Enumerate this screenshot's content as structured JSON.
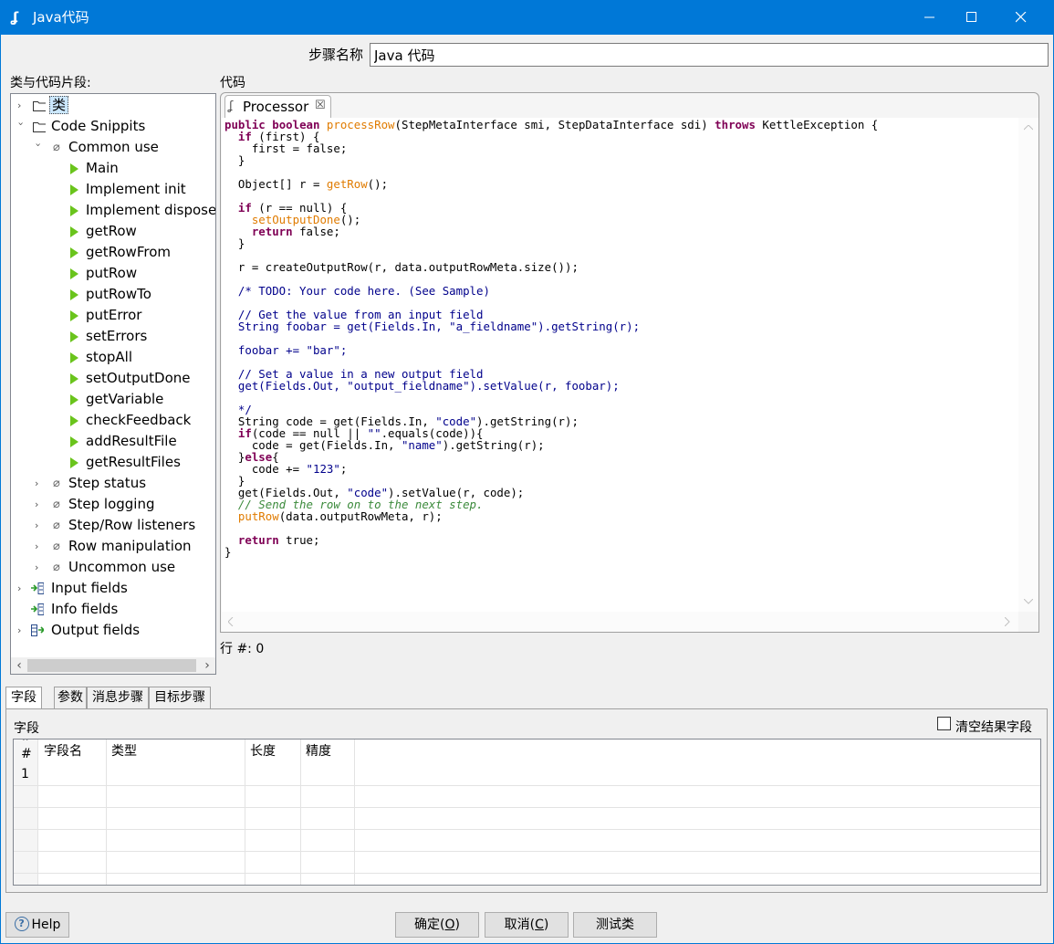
{
  "window": {
    "title": "Java代码"
  },
  "step": {
    "label": "步骤名称",
    "value": "Java 代码"
  },
  "tree": {
    "header": "类与代码片段:",
    "items": [
      {
        "label": "类"
      },
      {
        "label": "Code Snippits"
      },
      {
        "label": "Common use"
      },
      {
        "label": "Main"
      },
      {
        "label": "Implement init"
      },
      {
        "label": "Implement dispose"
      },
      {
        "label": "getRow"
      },
      {
        "label": "getRowFrom"
      },
      {
        "label": "putRow"
      },
      {
        "label": "putRowTo"
      },
      {
        "label": "putError"
      },
      {
        "label": "setErrors"
      },
      {
        "label": "stopAll"
      },
      {
        "label": "setOutputDone"
      },
      {
        "label": "getVariable"
      },
      {
        "label": "checkFeedback"
      },
      {
        "label": "addResultFile"
      },
      {
        "label": "getResultFiles"
      },
      {
        "label": "Step status"
      },
      {
        "label": "Step logging"
      },
      {
        "label": "Step/Row listeners"
      },
      {
        "label": "Row manipulation"
      },
      {
        "label": "Uncommon use"
      },
      {
        "label": "Input fields"
      },
      {
        "label": "Info fields"
      },
      {
        "label": "Output fields"
      }
    ]
  },
  "code": {
    "header": "代码",
    "tab_label": "Processor",
    "row_status": "行 #: 0"
  },
  "bottom": {
    "tabs": [
      "字段",
      "参数",
      "消息步骤",
      "目标步骤"
    ],
    "fields_label": "字段",
    "clear_label": "清空结果字段",
    "columns": [
      "#",
      "字段名",
      "类型",
      "长度",
      "精度"
    ],
    "rows": [
      {
        "num": "1"
      }
    ]
  },
  "buttons": {
    "help": "Help",
    "ok": "确定(",
    "ok_key": "O",
    "ok_end": ")",
    "cancel": "取消(",
    "cancel_key": "C",
    "cancel_end": ")",
    "test": "测试类"
  }
}
